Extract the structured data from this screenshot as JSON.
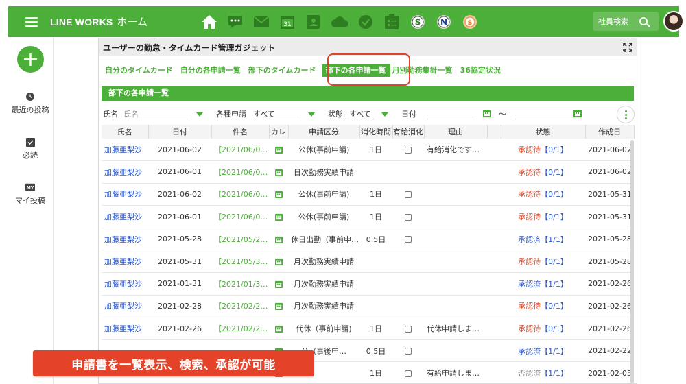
{
  "header": {
    "brand_en": "LINE WORKS",
    "brand_jp": "ホーム",
    "search_label": "社員検索",
    "apps": [
      "home-icon",
      "chat-icon",
      "mail-icon",
      "calendar-icon",
      "contacts-icon",
      "drive-icon",
      "task-icon",
      "form-icon",
      "s-app-icon",
      "n-app-icon",
      "coin-app-icon"
    ],
    "calendar_day": "31",
    "bar_color": "#4caf39"
  },
  "sidebar": {
    "items": [
      {
        "label": "最近の投稿",
        "icon": "clock-icon"
      },
      {
        "label": "必読",
        "icon": "check-box-icon"
      },
      {
        "label": "マイ投稿",
        "icon": "my-icon"
      }
    ]
  },
  "panel": {
    "title": "ユーザーの勤怠・タイムカード管理ガジェット",
    "tabs": [
      "自分のタイムカード",
      "自分の各申請一覧",
      "部下のタイムカード",
      "部下の各申請一覧",
      "月別勤務集計一覧",
      "36協定状況"
    ],
    "active_tab": 3,
    "section_title": "部下の各申請一覧"
  },
  "filters": {
    "name_label": "氏名",
    "name_placeholder": "氏名",
    "type_label": "各種申請",
    "type_value": "すべて",
    "status_label": "状態",
    "status_value": "すべて",
    "date_label": "日付",
    "date_sep": "〜"
  },
  "table": {
    "columns": [
      "氏名",
      "日付",
      "件名",
      "カレ",
      "申請区分",
      "消化時間",
      "有給消化",
      "理由",
      "",
      "状態",
      "作成日"
    ],
    "rows": [
      {
        "name": "加藤亜梨沙",
        "date": "2021-06-02",
        "subject": "【2021/06/0…",
        "kind": "公休(事前申請)",
        "time": "1日",
        "paid": true,
        "reason": "有給消化です…",
        "status": "承認待",
        "count": "【0/1】",
        "st": "wait",
        "created": "2021-06-02"
      },
      {
        "name": "加藤亜梨沙",
        "date": "2021-06-01",
        "subject": "【2021/06/0…",
        "kind": "日次勤務実績申請",
        "time": "",
        "paid": false,
        "reason": "",
        "status": "承認待",
        "count": "【0/1】",
        "st": "wait",
        "created": "2021-06-02"
      },
      {
        "name": "加藤亜梨沙",
        "date": "2021-06-02",
        "subject": "【2021/06/0…",
        "kind": "公休(事前申請)",
        "time": "1日",
        "paid": true,
        "reason": "",
        "status": "承認待",
        "count": "【0/1】",
        "st": "wait",
        "created": "2021-05-31"
      },
      {
        "name": "加藤亜梨沙",
        "date": "2021-06-01",
        "subject": "【2021/06/0…",
        "kind": "公休(事前申請)",
        "time": "1日",
        "paid": true,
        "reason": "",
        "status": "承認待",
        "count": "【0/1】",
        "st": "wait",
        "created": "2021-05-31"
      },
      {
        "name": "加藤亜梨沙",
        "date": "2021-05-28",
        "subject": "【2021/05/2…",
        "kind": "休日出勤（事前申…",
        "time": "0.5日",
        "paid": true,
        "reason": "",
        "status": "承認済",
        "count": "【1/1】",
        "st": "done",
        "created": "2021-05-28"
      },
      {
        "name": "加藤亜梨沙",
        "date": "2021-05-31",
        "subject": "【2021/05/3…",
        "kind": "月次勤務実績申請",
        "time": "",
        "paid": false,
        "reason": "",
        "status": "承認待",
        "count": "【0/1】",
        "st": "wait",
        "created": "2021-05-28"
      },
      {
        "name": "加藤亜梨沙",
        "date": "2021-01-31",
        "subject": "【2021/01/3…",
        "kind": "月次勤務実績申請",
        "time": "",
        "paid": false,
        "reason": "",
        "status": "承認済",
        "count": "【1/1】",
        "st": "done",
        "created": "2021-02-26"
      },
      {
        "name": "加藤亜梨沙",
        "date": "2021-02-28",
        "subject": "【2021/02/2…",
        "kind": "月次勤務実績申請",
        "time": "",
        "paid": false,
        "reason": "",
        "status": "承認待",
        "count": "【0/1】",
        "st": "wait",
        "created": "2021-02-26"
      },
      {
        "name": "加藤亜梨沙",
        "date": "2021-02-26",
        "subject": "【2021/02/2…",
        "kind": "代休（事前申請)",
        "time": "1日",
        "paid": true,
        "reason": "代休申請しま…",
        "status": "承認待",
        "count": "【0/1】",
        "st": "wait",
        "created": "2021-02-26"
      },
      {
        "name": "",
        "date": "",
        "subject": "",
        "kind": "公（事後申…",
        "time": "0.5日",
        "paid": true,
        "reason": "",
        "status": "承認済",
        "count": "【1/1】",
        "st": "done",
        "created": "2021-02-22"
      },
      {
        "name": "",
        "date": "",
        "subject": "",
        "kind": "",
        "time": "1日",
        "paid": true,
        "reason": "有給申請しま…",
        "status": "否認済",
        "count": "【1/1】",
        "st": "no",
        "created": "2021-02-05"
      }
    ]
  },
  "caption": "申請書を一覧表示、検索、承認が可能"
}
